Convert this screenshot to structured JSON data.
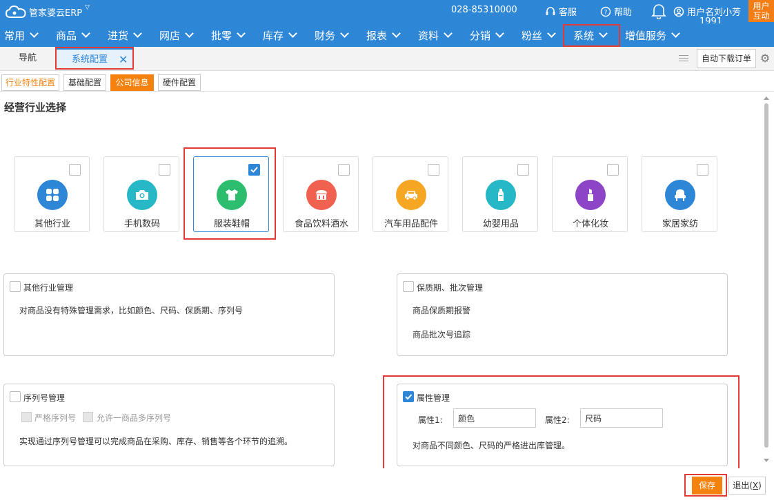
{
  "app": {
    "logo_text": "管家婆云ERP",
    "phone": "028-85310000",
    "service_label": "客服",
    "help_label": "帮助",
    "user_label": "用户名刘小芳",
    "user_id": "1991",
    "user_badge_line1": "用户",
    "user_badge_line2": "互动"
  },
  "menu": {
    "items": [
      "常用",
      "商品",
      "进货",
      "网店",
      "批零",
      "库存",
      "财务",
      "报表",
      "资料",
      "分销",
      "粉丝",
      "系统",
      "增值服务"
    ]
  },
  "tabs": {
    "nav_label": "导航",
    "current_label": "系统配置",
    "close_glyph": "✕",
    "auto_download_label": "自动下载订单"
  },
  "subtabs": [
    "行业特性配置",
    "基础配置",
    "公司信息",
    "硬件配置"
  ],
  "section_title": "经营行业选择",
  "industries": [
    {
      "label": "其他行业",
      "color": "#2e86d7",
      "icon": "apps-icon",
      "selected": false
    },
    {
      "label": "手机数码",
      "color": "#26b8c6",
      "icon": "camera-icon",
      "selected": false
    },
    {
      "label": "服装鞋帽",
      "color": "#2dbd6e",
      "icon": "tshirt-icon",
      "selected": true
    },
    {
      "label": "食品饮料酒水",
      "color": "#f0614f",
      "icon": "shop-icon",
      "selected": false
    },
    {
      "label": "汽车用品配件",
      "color": "#f5a623",
      "icon": "car-icon",
      "selected": false
    },
    {
      "label": "幼婴用品",
      "color": "#26b8c6",
      "icon": "bottle-icon",
      "selected": false
    },
    {
      "label": "个体化妆",
      "color": "#8e44c6",
      "icon": "cosmetic-icon",
      "selected": false
    },
    {
      "label": "家居家纺",
      "color": "#2e86d7",
      "icon": "chair-icon",
      "selected": false
    }
  ],
  "panels": {
    "other": {
      "title": "其他行业管理",
      "desc": "对商品没有特殊管理需求，比如颜色、尺码、保质期、序列号",
      "checked": false
    },
    "shelf": {
      "title": "保质期、批次管理",
      "line1": "商品保质期报警",
      "line2": "商品批次号追踪",
      "checked": false
    },
    "serial": {
      "title": "序列号管理",
      "opt1": "严格序列号",
      "opt2": "允许一商品多序列号",
      "desc": "实现通过序列号管理可以完成商品在采购、库存、销售等各个环节的追溯。",
      "checked": false
    },
    "attr": {
      "title": "属性管理",
      "attr1_label": "属性1:",
      "attr1_value": "颜色",
      "attr2_label": "属性2:",
      "attr2_value": "尺码",
      "desc": "对商品不同颜色、尺码的严格进出库管理。",
      "checked": true
    }
  },
  "footer": {
    "save_label": "保存",
    "exit_label": "退出(",
    "exit_key": "X",
    "exit_close": ")"
  },
  "colors": {
    "brand": "#2e86d7",
    "accent": "#f5820e",
    "highlight": "#e53935"
  }
}
